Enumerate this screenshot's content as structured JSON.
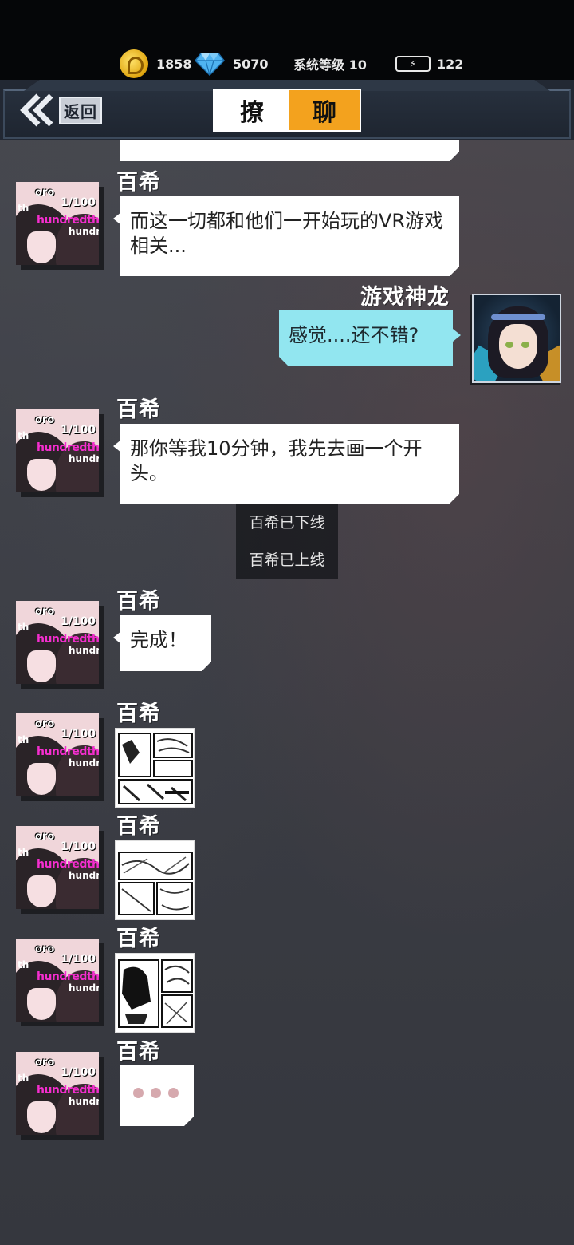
{
  "status": {
    "coins": "1858",
    "gems": "5070",
    "system_level_label": "系统等级 10",
    "energy": "122"
  },
  "header": {
    "back_label": "返回",
    "title_part1": "撩",
    "title_part2": "聊"
  },
  "chat": {
    "messages": [
      {
        "sender": "百希",
        "text": "而这一切都和他们一开始玩的VR游戏相关..."
      },
      {
        "sender": "游戏神龙",
        "text": "感觉....还不错?"
      },
      {
        "sender": "百希",
        "text": "那你等我10分钟，我先去画一个开头。"
      },
      {
        "sender": "百希",
        "text": "完成！"
      },
      {
        "sender": "百希",
        "type": "image"
      },
      {
        "sender": "百希",
        "type": "image"
      },
      {
        "sender": "百希",
        "type": "image"
      },
      {
        "sender": "百希",
        "type": "typing"
      }
    ],
    "system_notices": [
      "百希已下线",
      "百希已上线"
    ]
  },
  "avatar_text": {
    "line1": "oro",
    "line2": "1/100",
    "line3": "hundredth",
    "line4": "hundr",
    "line5": "th"
  },
  "colors": {
    "coin": "#e0a50f",
    "title_accent": "#f3a21e",
    "self_bubble": "#92e6f0",
    "other_bubble": "#ffffff"
  }
}
